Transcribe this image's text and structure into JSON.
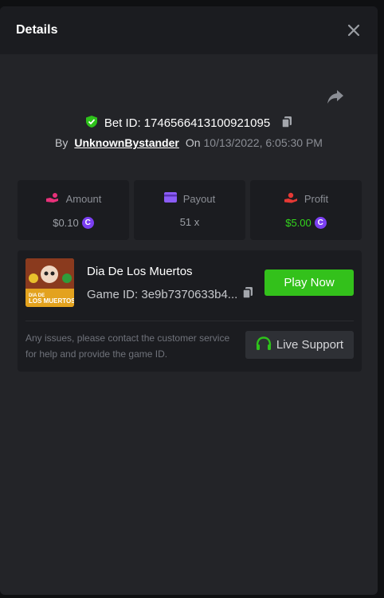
{
  "header": {
    "title": "Details"
  },
  "bet": {
    "label": "Bet ID:",
    "id": "1746566413100921095",
    "by_label": "By",
    "user": "UnknownBystander",
    "on_label": "On",
    "date": "10/13/2022, 6:05:30 PM"
  },
  "stats": {
    "amount": {
      "label": "Amount",
      "value": "$0.10"
    },
    "payout": {
      "label": "Payout",
      "value": "51 x"
    },
    "profit": {
      "label": "Profit",
      "value": "$5.00"
    }
  },
  "game": {
    "name": "Dia De Los Muertos",
    "id_text": "Game ID: 3e9b7370633b4...",
    "thumb_text_line1": "DIA DE",
    "thumb_text_line2": "LOS MUERTOS",
    "play_label": "Play Now",
    "issue_text": "Any issues, please contact the customer service for help and provide the game ID.",
    "support_label": "Live Support"
  },
  "icons": {
    "close": "close-icon",
    "share": "share-icon",
    "shield": "shield-check-icon",
    "copy": "copy-icon",
    "amount": "hand-coins-icon",
    "payout": "card-icon",
    "profit": "hand-profit-icon",
    "coin": "coin-icon",
    "headset": "headset-icon"
  },
  "colors": {
    "accent_green": "#33c11b",
    "profit_green": "#33d61c",
    "amount_pink": "#e8317a",
    "payout_purple": "#8b5cf6",
    "profit_red": "#e53935",
    "coin_purple": "#7b3ff2"
  }
}
